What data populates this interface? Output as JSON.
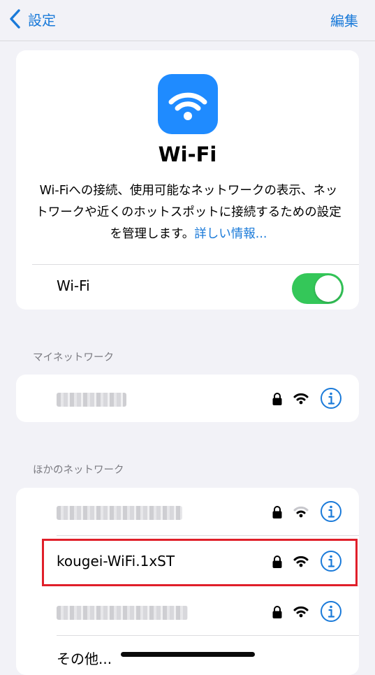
{
  "nav": {
    "back_label": "設定",
    "edit_label": "編集"
  },
  "hero": {
    "icon": "wifi-icon",
    "title": "Wi-Fi",
    "description": "Wi-Fiへの接続、使用可能なネットワークの表示、ネットワークや近くのホットスポットに接続するための設定を管理します。",
    "link": "詳しい情報..."
  },
  "wifi_toggle": {
    "label": "Wi-Fi",
    "on": true
  },
  "my_networks": {
    "header": "マイネットワーク",
    "items": [
      {
        "name": "",
        "redacted": true,
        "locked": true,
        "signal": "full"
      }
    ]
  },
  "other_networks": {
    "header": "ほかのネットワーク",
    "items": [
      {
        "name": "",
        "redacted": true,
        "locked": true,
        "signal": "weak"
      },
      {
        "name": "kougei-WiFi.1xST",
        "redacted": false,
        "locked": true,
        "signal": "full",
        "highlighted": true
      },
      {
        "name": "",
        "redacted": true,
        "locked": true,
        "signal": "full"
      }
    ],
    "other_label": "その他..."
  },
  "colors": {
    "accent": "#1a7ad9",
    "toggle_on": "#34c759",
    "highlight": "#e01f2a",
    "app_icon": "#1f8bff"
  }
}
